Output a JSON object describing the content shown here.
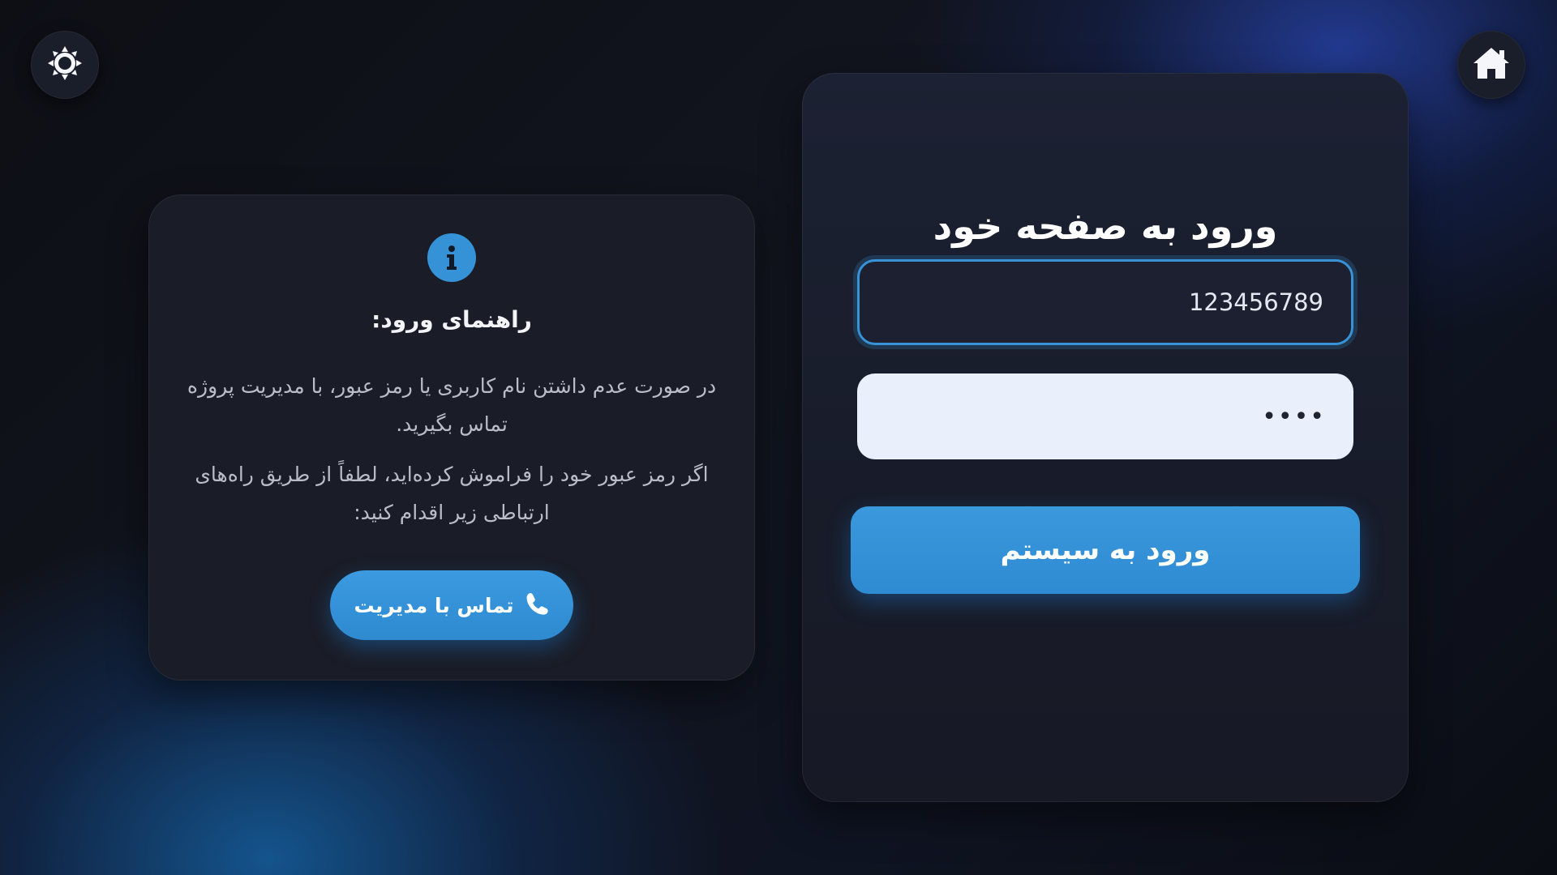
{
  "header": {
    "theme_icon": "sun-icon",
    "home_icon": "home-icon"
  },
  "login": {
    "title": "ورود به صفحه خود",
    "username_value": "123456789",
    "password_value": "••••",
    "submit_label": "ورود به سیستم"
  },
  "info": {
    "icon": "info-icon",
    "heading": "راهنمای ورود:",
    "paragraph_1": "در صورت عدم داشتن نام کاربری یا رمز عبور، با مدیریت پروژه تماس بگیرید.",
    "paragraph_2": "اگر رمز عبور خود را فراموش کرده‌اید، لطفاً از طریق راه‌های ارتباطی زیر اقدام کنید:",
    "contact_label": "تماس با مدیریت",
    "contact_icon": "phone-icon"
  },
  "colors": {
    "accent": "#3592d7",
    "card_background": "#1a1d27",
    "page_background": "#0d0f15"
  }
}
